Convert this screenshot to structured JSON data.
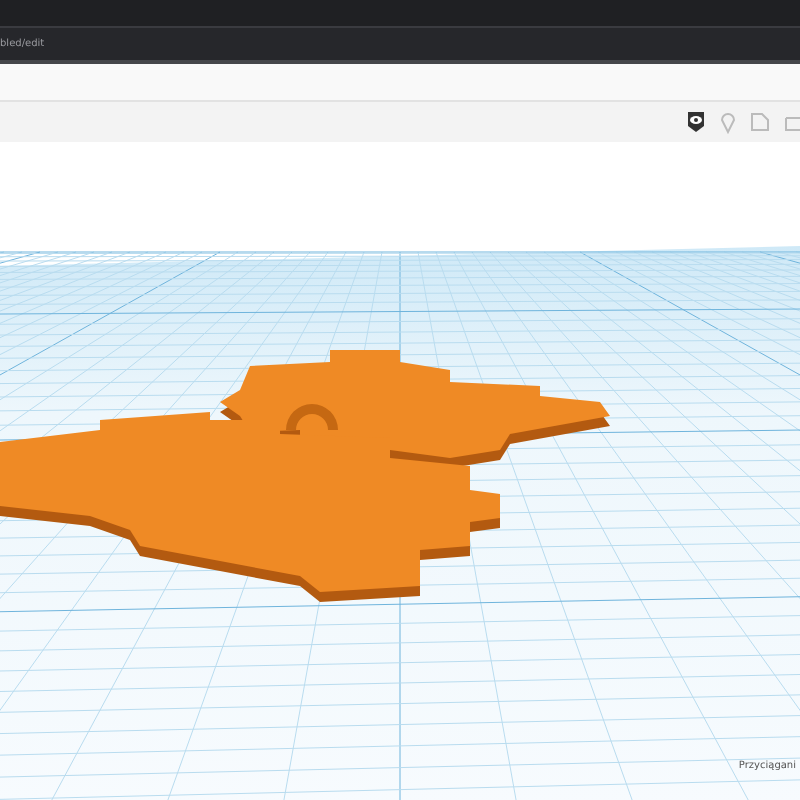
{
  "address_bar": {
    "url": "bled/edit"
  },
  "workplane": {
    "snap_label": "Przyciągani"
  }
}
